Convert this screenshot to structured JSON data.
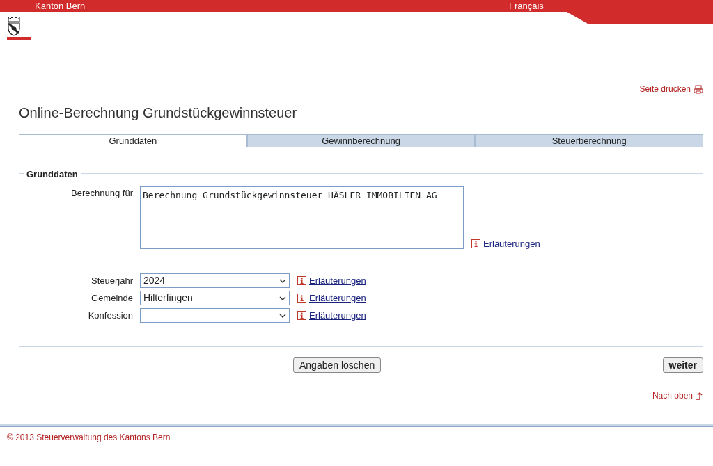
{
  "header": {
    "site": "Kanton Bern",
    "language": "Français"
  },
  "print_link": "Seite drucken",
  "title": "Online-Berechnung Grundstückgewinnsteuer",
  "steps": [
    {
      "label": "Grunddaten",
      "selected": true
    },
    {
      "label": "Gewinnberechnung",
      "selected": false
    },
    {
      "label": "Steuerberechnung",
      "selected": false
    }
  ],
  "section": {
    "legend": "Grunddaten",
    "textarea": {
      "label": "Berechnung für",
      "value": "Berechnung Grundstückgewinnsteuer HÄSLER IMMOBILIEN AG",
      "help": "Erläuterungen"
    },
    "selects": [
      {
        "label": "Steuerjahr",
        "value": "2024",
        "help": "Erläuterungen"
      },
      {
        "label": "Gemeinde",
        "value": "Hilterfingen",
        "help": "Erläuterungen"
      },
      {
        "label": "Konfession",
        "help": "Erläuterungen"
      }
    ]
  },
  "buttons": {
    "clear": "Angaben löschen",
    "next": "weiter"
  },
  "top_link": "Nach oben",
  "footer": "© 2013 Steuerverwaltung des Kantons Bern"
}
